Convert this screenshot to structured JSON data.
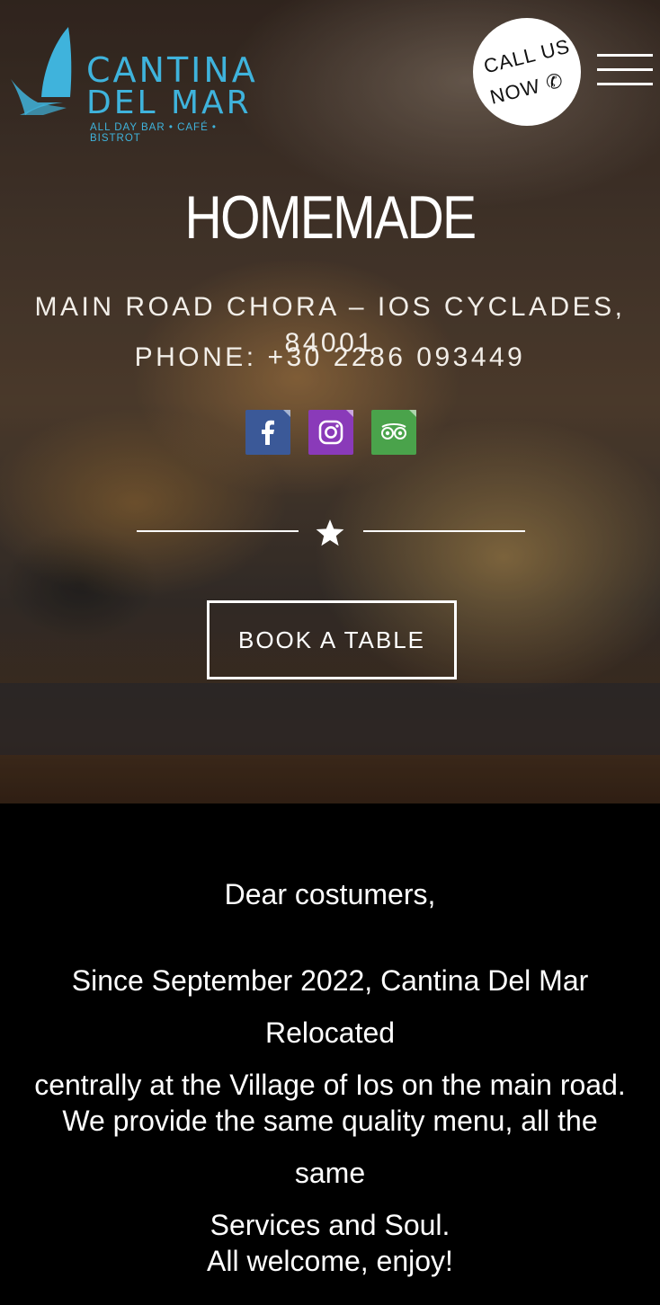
{
  "brand": {
    "name_line1": "CANTINA",
    "name_line2": "DEL MAR",
    "tagline": "ALL DAY BAR • CAFÉ • BISTROT",
    "color": "#3fb3dc"
  },
  "call_button": {
    "line1": "CALL US",
    "line2": "NOW ✆"
  },
  "menu": {
    "icon": "hamburger-menu-icon"
  },
  "hero": {
    "title": "HOMEMADE",
    "address": "MAIN ROAD CHORA – IOS CYCLADES, 84001",
    "phone": "PHONE: +30 2286 093449",
    "book_label": "BOOK A TABLE"
  },
  "social": [
    {
      "name": "facebook",
      "icon": "facebook-icon",
      "color": "#3b5998"
    },
    {
      "name": "instagram",
      "icon": "instagram-icon",
      "color": "#8a3ab9"
    },
    {
      "name": "tripadvisor",
      "icon": "tripadvisor-icon",
      "color": "#4aa34b"
    }
  ],
  "notice": {
    "greeting": "Dear costumers,",
    "para1_line1": "Since September 2022, Cantina Del Mar Relocated",
    "para1_line2": "centrally at the Village of Ios on the main road.",
    "para2_line1": "We provide the same quality menu, all the same",
    "para2_line2": "Services and Soul.",
    "closing": "All welcome, enjoy!"
  }
}
